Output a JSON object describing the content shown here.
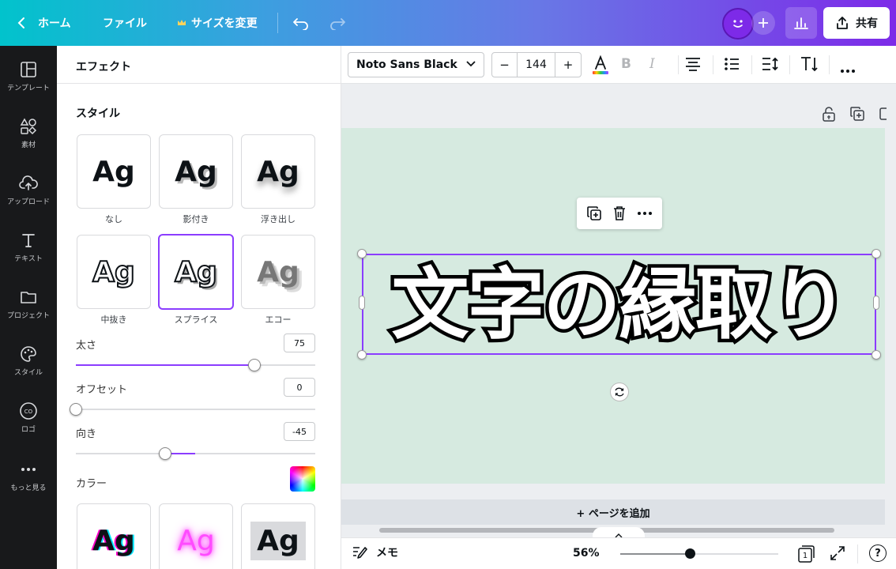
{
  "topbar": {
    "home_label": "ホーム",
    "file_label": "ファイル",
    "resize_label": "サイズを変更",
    "share_label": "共有"
  },
  "rail": {
    "items": [
      {
        "label": "テンプレート",
        "icon": "template-icon"
      },
      {
        "label": "素材",
        "icon": "elements-icon"
      },
      {
        "label": "アップロード",
        "icon": "upload-icon"
      },
      {
        "label": "テキスト",
        "icon": "text-icon"
      },
      {
        "label": "プロジェクト",
        "icon": "folder-icon"
      },
      {
        "label": "スタイル",
        "icon": "palette-icon"
      },
      {
        "label": "ロゴ",
        "icon": "logo-icon"
      },
      {
        "label": "もっと見る",
        "icon": "more-icon"
      }
    ]
  },
  "panel": {
    "title": "エフェクト",
    "style_heading": "スタイル",
    "card_text": "Ag",
    "styles": [
      "なし",
      "影付き",
      "浮き出し",
      "中抜き",
      "スプライス",
      "エコー"
    ],
    "selected_style": "スプライス",
    "sliders": [
      {
        "label": "太さ",
        "value": "75",
        "level": 75
      },
      {
        "label": "オフセット",
        "value": "0",
        "level": 0
      },
      {
        "label": "向き",
        "value": "-45",
        "level": -45
      }
    ],
    "color_label": "カラー"
  },
  "format_bar": {
    "font_name": "Noto Sans Black",
    "font_size": "144",
    "minus": "−",
    "plus": "+"
  },
  "canvas": {
    "main_text": "文字の縁取り",
    "add_page_label": "+ ページを追加",
    "bg_color": "#d6eae0"
  },
  "bottom": {
    "notes_label": "メモ",
    "zoom": "56%",
    "page_count": "1",
    "help": "?"
  },
  "colors": {
    "accent": "#8b3dff"
  }
}
